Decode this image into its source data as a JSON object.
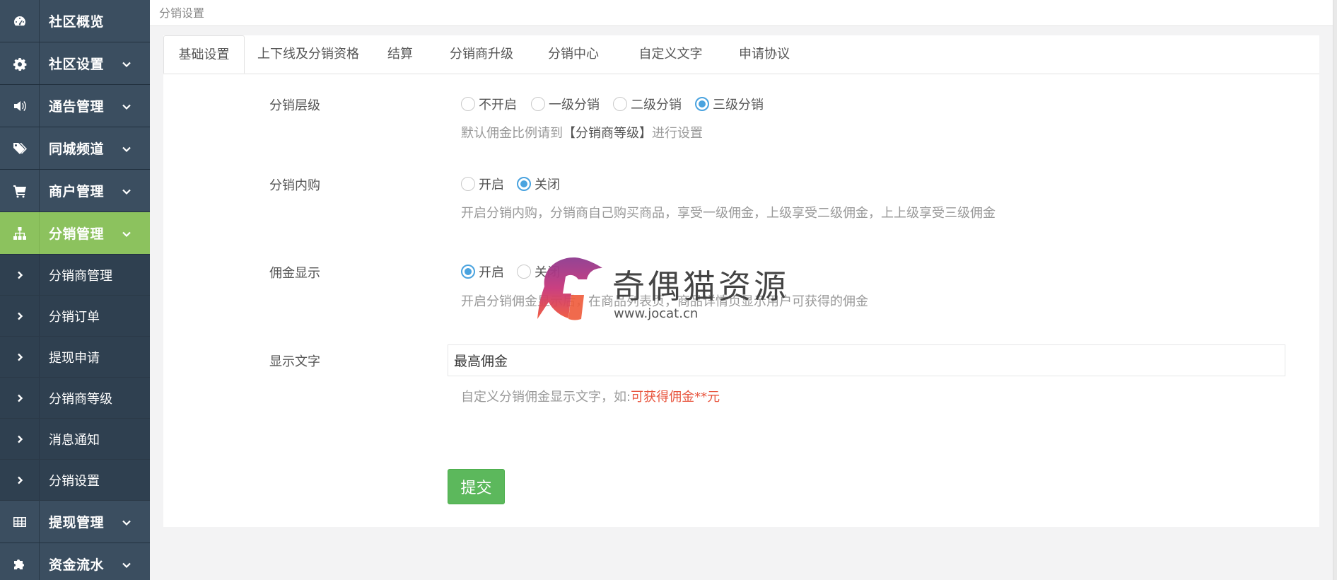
{
  "sidebar": {
    "top_items": [
      {
        "label": "社区概览",
        "icon": "dashboard-icon",
        "has_arrow": false
      },
      {
        "label": "社区设置",
        "icon": "gear-icon",
        "has_arrow": true
      },
      {
        "label": "通告管理",
        "icon": "speaker-icon",
        "has_arrow": true
      },
      {
        "label": "同城频道",
        "icon": "tags-icon",
        "has_arrow": true
      },
      {
        "label": "商户管理",
        "icon": "cart-icon",
        "has_arrow": true
      },
      {
        "label": "分销管理",
        "icon": "sitemap-icon",
        "has_arrow": true,
        "active": true
      }
    ],
    "sub_items": [
      {
        "label": "分销商管理"
      },
      {
        "label": "分销订单"
      },
      {
        "label": "提现申请"
      },
      {
        "label": "分销商等级"
      },
      {
        "label": "消息通知"
      },
      {
        "label": "分销设置"
      }
    ],
    "bottom_items": [
      {
        "label": "提现管理",
        "icon": "table-icon",
        "has_arrow": true
      },
      {
        "label": "资金流水",
        "icon": "puzzle-icon",
        "has_arrow": true
      }
    ],
    "active_color": "#8cc25e",
    "bg_color": "#2f4050"
  },
  "breadcrumb": "分销设置",
  "tabs": [
    {
      "label": "基础设置",
      "active": true
    },
    {
      "label": "上下线及分销资格"
    },
    {
      "label": "结算"
    },
    {
      "label": "分销商升级"
    },
    {
      "label": "分销中心"
    },
    {
      "label": "自定义文字"
    },
    {
      "label": "申请协议"
    }
  ],
  "form": {
    "level": {
      "label": "分销层级",
      "options": [
        "不开启",
        "一级分销",
        "二级分销",
        "三级分销"
      ],
      "selected": 3,
      "help_prefix": "默认佣金比例请到",
      "help_bold": "【分销商等级】",
      "help_suffix": "进行设置"
    },
    "self_buy": {
      "label": "分销内购",
      "options": [
        "开启",
        "关闭"
      ],
      "selected": 1,
      "help": "开启分销内购，分销商自己购买商品，享受一级佣金，上级享受二级佣金，上上级享受三级佣金"
    },
    "commission_display": {
      "label": "佣金显示",
      "options": [
        "开启",
        "关闭"
      ],
      "selected": 0,
      "help": "开启分销佣金显示后，在商品列表页，商品详情页显示用户可获得的佣金"
    },
    "display_text": {
      "label": "显示文字",
      "value": "最高佣金",
      "help_prefix": "自定义分销佣金显示文字，如:",
      "help_example": "可获得佣金**元"
    },
    "submit_label": "提交"
  },
  "watermark": {
    "title": "奇偶猫资源",
    "url": "www.jocat.cn"
  },
  "colors": {
    "radio_checked": "#4aa3df",
    "submit": "#5cb85c",
    "help_red": "#e8563f"
  }
}
